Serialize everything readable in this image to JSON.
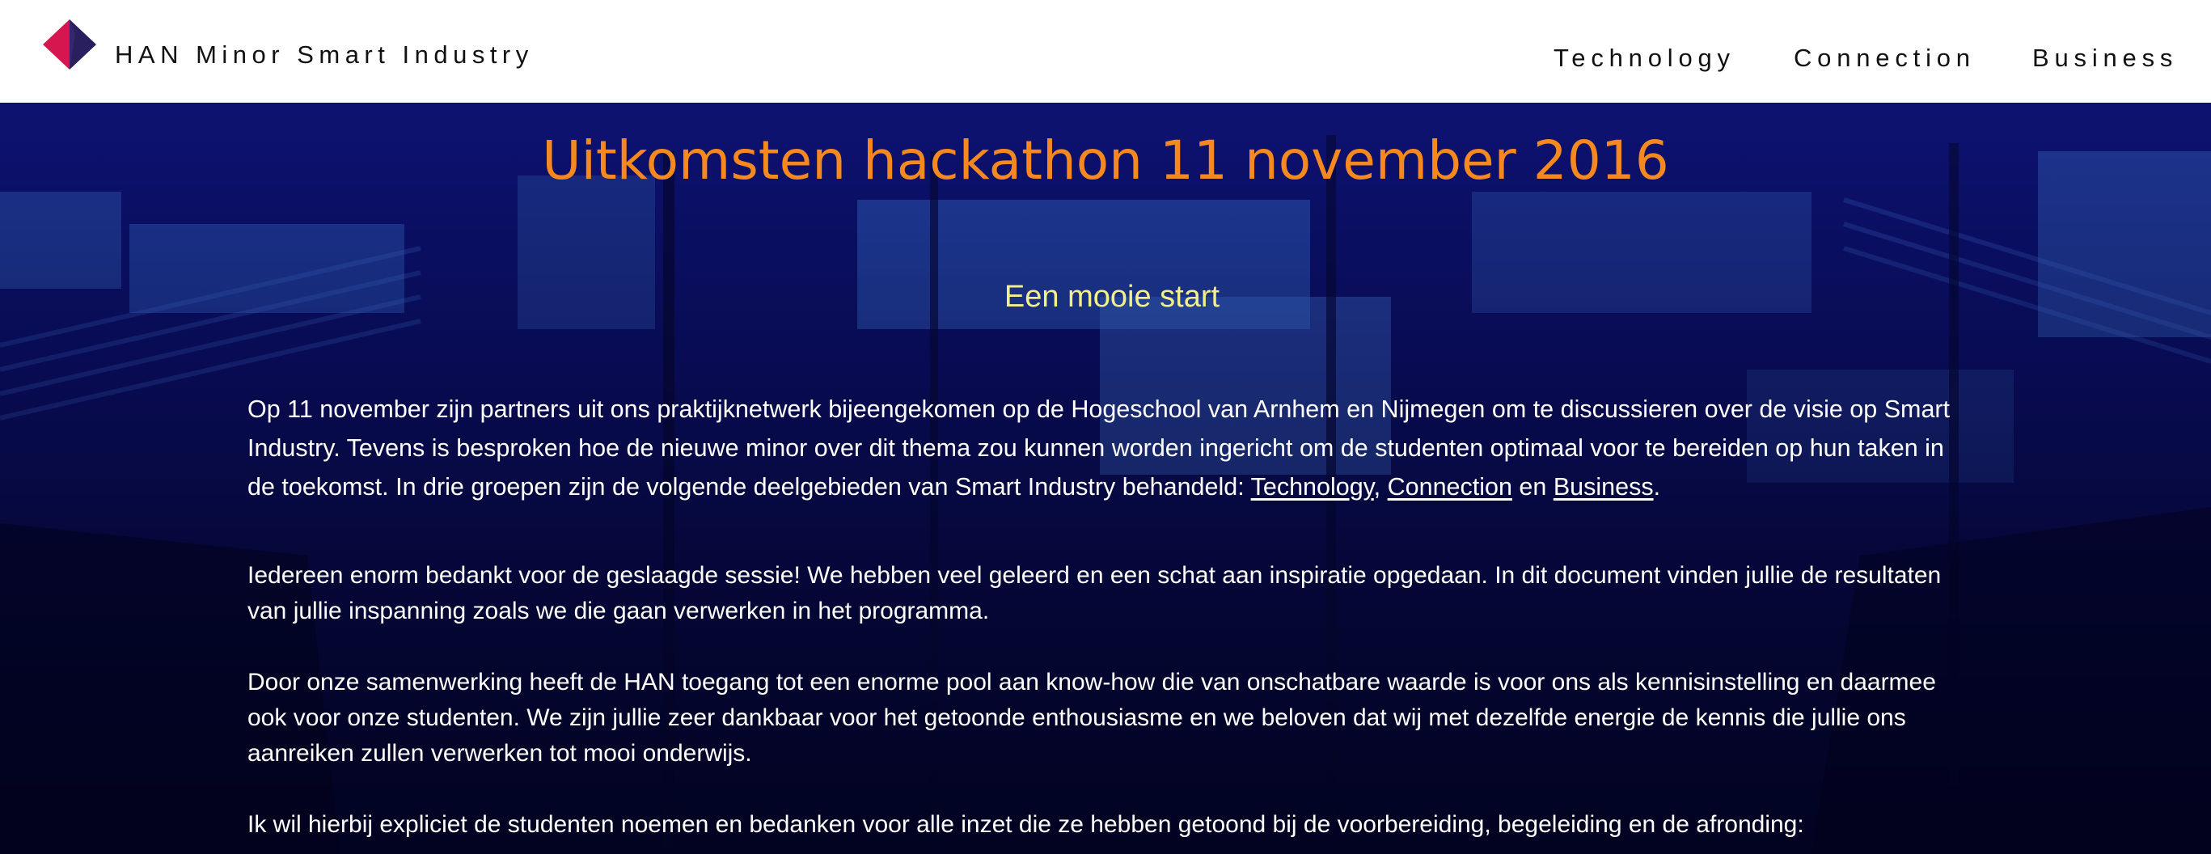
{
  "header": {
    "brand": "HAN Minor Smart Industry",
    "nav": [
      "Technology",
      "Connection",
      "Business"
    ],
    "logo_colors": {
      "left": "#d5164f",
      "right": "#2a1f5e"
    }
  },
  "main": {
    "title": "Uitkomsten hackathon 11 november 2016",
    "subtitle": "Een mooie start",
    "p1": {
      "text": "Op 11 november zijn partners uit ons praktijknetwerk bijeengekomen op de Hogeschool van Arnhem en Nijmegen om te discussieren over de visie op Smart Industry. Tevens is besproken hoe de nieuwe minor over dit thema zou kunnen worden ingericht om de studenten optimaal voor te bereiden op hun taken in de toekomst. In drie groepen zijn de volgende deelgebieden van Smart Industry behandeld: ",
      "link1": "Technology",
      "sep1": ", ",
      "link2": "Connection",
      "sep2": " en ",
      "link3": "Business",
      "end": "."
    },
    "p2": "Iedereen enorm bedankt voor de geslaagde sessie! We hebben veel geleerd en een schat aan inspiratie opgedaan. In dit document vinden jullie de resultaten van jullie inspanning zoals we die gaan verwerken in het programma.",
    "p3": "Door onze samenwerking heeft de HAN toegang tot een enorme pool aan know-how die van onschatbare waarde is voor ons als kennisinstelling en daarmee ook voor onze studenten. We zijn jullie zeer dankbaar voor het getoonde enthousiasme en we beloven dat wij met dezelfde energie de kennis die jullie ons aanreiken zullen verwerken tot mooi onderwijs.",
    "p4": "Ik wil hierbij expliciet de studenten noemen en bedanken voor alle inzet die ze hebben getoond bij de voorbereiding, begeleiding en de afronding:"
  },
  "colors": {
    "title": "#f5891f",
    "subtitle": "#f4f089",
    "background": "#0a0e62",
    "header_bg": "#ffffff"
  }
}
